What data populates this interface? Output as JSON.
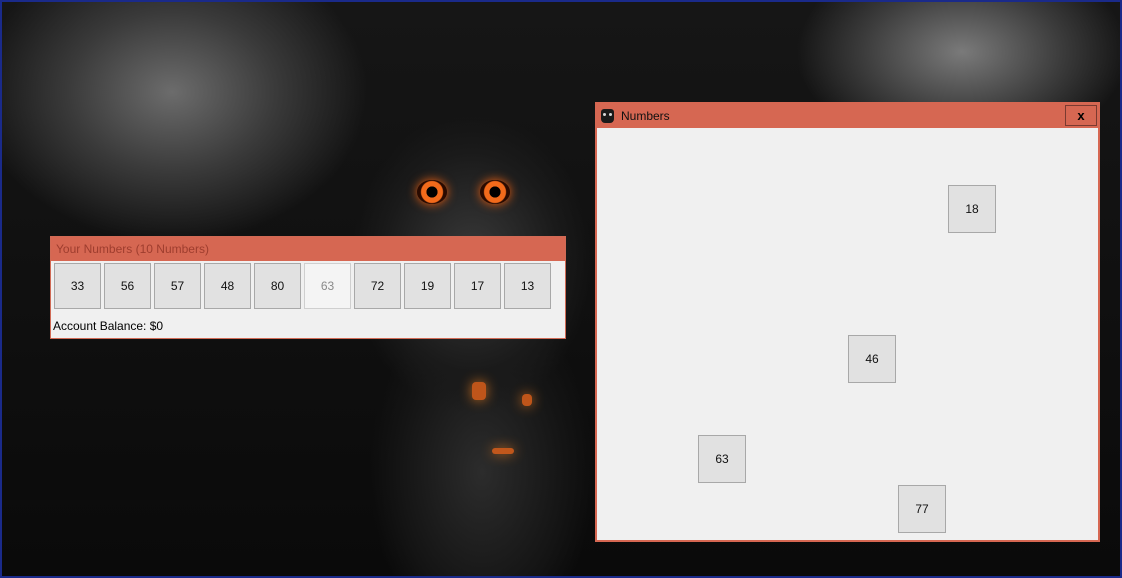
{
  "left_window": {
    "title": "Your Numbers (10 Numbers)",
    "numbers": [
      {
        "label": "33",
        "enabled": true
      },
      {
        "label": "56",
        "enabled": true
      },
      {
        "label": "57",
        "enabled": true
      },
      {
        "label": "48",
        "enabled": true
      },
      {
        "label": "80",
        "enabled": true
      },
      {
        "label": "63",
        "enabled": false
      },
      {
        "label": "72",
        "enabled": true
      },
      {
        "label": "19",
        "enabled": true
      },
      {
        "label": "17",
        "enabled": true
      },
      {
        "label": "13",
        "enabled": true
      }
    ],
    "balance": "Account Balance: $0"
  },
  "right_window": {
    "title": "Numbers",
    "icon": "owl-app-icon",
    "close_label": "x",
    "numbers": [
      "18",
      "46",
      "63",
      "77"
    ]
  },
  "colors": {
    "titlebar": "#d66752",
    "window_bg": "#f0f0f0",
    "button_bg": "#e1e1e1",
    "desktop_border": "#1a2a8a"
  }
}
